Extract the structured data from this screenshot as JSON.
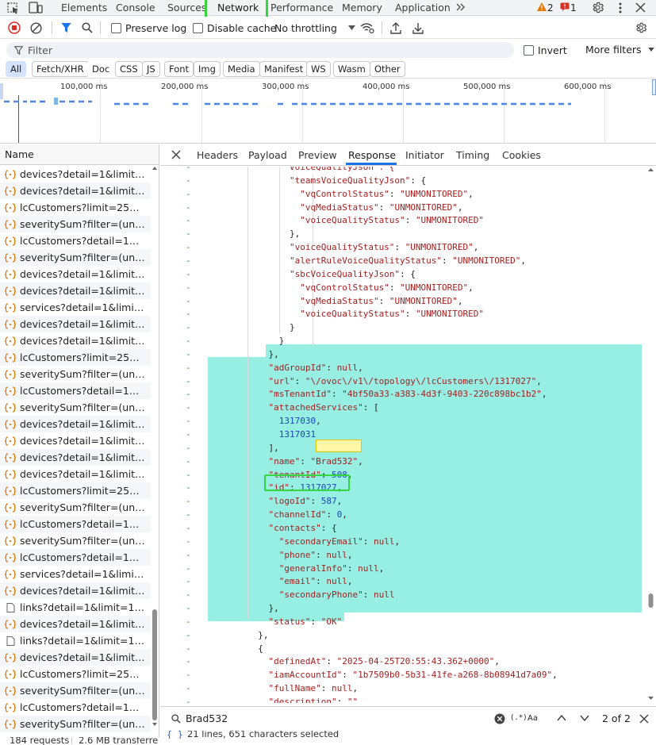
{
  "tabs": [
    "Elements",
    "Console",
    "Sources",
    "Network",
    "Performance",
    "Memory",
    "Application"
  ],
  "active_tab": "Network",
  "badges": {
    "warnings": "2",
    "errors": "1"
  },
  "toolbar": {
    "preserve_log": "Preserve log",
    "disable_cache": "Disable cache",
    "throttling": "No throttling"
  },
  "filter": {
    "placeholder": "Filter",
    "invert": "Invert",
    "more_filters": "More filters"
  },
  "type_filters": [
    "All",
    "Fetch/XHR",
    "Doc",
    "CSS",
    "JS",
    "Font",
    "Img",
    "Media",
    "Manifest",
    "WS",
    "Wasm",
    "Other"
  ],
  "timeline_ticks": [
    "100,000 ms",
    "200,000 ms",
    "300,000 ms",
    "400,000 ms",
    "500,000 ms",
    "600,000 ms"
  ],
  "list_header": "Name",
  "requests": [
    "devices?detail=1&limit=100...",
    "devices?detail=1&limit=100...",
    "lcCustomers?limit=25&pag...",
    "severitySum?filter=(unitTyp...",
    "lcCustomers?detail=1&filter...",
    "severitySum?filter=(unitTyp...",
    "devices?detail=1&limit=100...",
    "devices?detail=1&limit=100...",
    "services?detail=1&limit=10...",
    "devices?detail=1&limit=100...",
    "devices?detail=1&limit=100...",
    "lcCustomers?limit=25&pag...",
    "severitySum?filter=(unitTyp...",
    "lcCustomers?detail=1&filter...",
    "severitySum?filter=(unitTyp...",
    "devices?detail=1&limit=100...",
    "devices?detail=1&limit=100...",
    "devices?detail=1&limit=100...",
    "devices?detail=1&limit=100...",
    "lcCustomers?limit=25&pag...",
    "severitySum?filter=(unitTyp...",
    "lcCustomers?detail=1&filter...",
    "severitySum?filter=(unitTyp...",
    "lcCustomers?detail=1&limit...",
    "services?detail=1&limit=10...",
    "devices?detail=1&limit=100...",
    "links?detail=1&limit=10000...",
    "devices?detail=1&limit=100...",
    "links?detail=1&limit=10000...",
    "devices?detail=1&limit=100...",
    "lcCustomers?limit=25&pag...",
    "severitySum?filter=(unitTyp...",
    "lcCustomers?detail=1&filter...",
    "severitySum?filter=(unitTyp..."
  ],
  "detail_tabs": [
    "Headers",
    "Payload",
    "Preview",
    "Response",
    "Initiator",
    "Timing",
    "Cookies"
  ],
  "active_detail_tab": "Response",
  "response_lines": [
    [
      {
        "t": "        voiceQualityJson\": {",
        "c": "k"
      }
    ],
    [
      {
        "t": "        \"teamsVoiceQualityJson\"",
        "c": "k"
      },
      {
        "t": ": {",
        "c": "p"
      }
    ],
    [
      {
        "t": "          \"vqControlStatus\"",
        "c": "k"
      },
      {
        "t": ": ",
        "c": "p"
      },
      {
        "t": "\"UNMONITORED\"",
        "c": "s"
      },
      {
        "t": ",",
        "c": "p"
      }
    ],
    [
      {
        "t": "          \"vqMediaStatus\"",
        "c": "k"
      },
      {
        "t": ": ",
        "c": "p"
      },
      {
        "t": "\"UNMONITORED\"",
        "c": "s"
      },
      {
        "t": ",",
        "c": "p"
      }
    ],
    [
      {
        "t": "          \"voiceQualityStatus\"",
        "c": "k"
      },
      {
        "t": ": ",
        "c": "p"
      },
      {
        "t": "\"UNMONITORED\"",
        "c": "s"
      }
    ],
    [
      {
        "t": "        },",
        "c": "p"
      }
    ],
    [
      {
        "t": "        \"voiceQualityStatus\"",
        "c": "k"
      },
      {
        "t": ": ",
        "c": "p"
      },
      {
        "t": "\"UNMONITORED\"",
        "c": "s"
      },
      {
        "t": ",",
        "c": "p"
      }
    ],
    [
      {
        "t": "        \"alertRuleVoiceQualityStatus\"",
        "c": "k"
      },
      {
        "t": ": ",
        "c": "p"
      },
      {
        "t": "\"UNMONITORED\"",
        "c": "s"
      },
      {
        "t": ",",
        "c": "p"
      }
    ],
    [
      {
        "t": "        \"sbcVoiceQualityJson\"",
        "c": "k"
      },
      {
        "t": ": {",
        "c": "p"
      }
    ],
    [
      {
        "t": "          \"vqControlStatus\"",
        "c": "k"
      },
      {
        "t": ": ",
        "c": "p"
      },
      {
        "t": "\"UNMONITORED\"",
        "c": "s"
      },
      {
        "t": ",",
        "c": "p"
      }
    ],
    [
      {
        "t": "          \"vqMediaStatus\"",
        "c": "k"
      },
      {
        "t": ": ",
        "c": "p"
      },
      {
        "t": "\"UNMONITORED\"",
        "c": "s"
      },
      {
        "t": ",",
        "c": "p"
      }
    ],
    [
      {
        "t": "          \"voiceQualityStatus\"",
        "c": "k"
      },
      {
        "t": ": ",
        "c": "p"
      },
      {
        "t": "\"UNMONITORED\"",
        "c": "s"
      }
    ],
    [
      {
        "t": "        }",
        "c": "p"
      }
    ],
    [
      {
        "t": "      }",
        "c": "p"
      }
    ],
    [
      {
        "t": "    },",
        "c": "p"
      }
    ],
    [
      {
        "t": "    \"adGroupId\"",
        "c": "k"
      },
      {
        "t": ": ",
        "c": "p"
      },
      {
        "t": "null",
        "c": "nul"
      },
      {
        "t": ",",
        "c": "p"
      }
    ],
    [
      {
        "t": "    \"url\"",
        "c": "k"
      },
      {
        "t": ": ",
        "c": "p"
      },
      {
        "t": "\"\\/ovoc\\/v1\\/topology\\/lcCustomers\\/1317027\"",
        "c": "s"
      },
      {
        "t": ",",
        "c": "p"
      }
    ],
    [
      {
        "t": "    \"msTenantId\"",
        "c": "k"
      },
      {
        "t": ": ",
        "c": "p"
      },
      {
        "t": "\"4bf50a33-a383-4d3f-9403-220c898bc1b2\"",
        "c": "s"
      },
      {
        "t": ",",
        "c": "p"
      }
    ],
    [
      {
        "t": "    \"attachedServices\"",
        "c": "k"
      },
      {
        "t": ": [",
        "c": "p"
      }
    ],
    [
      {
        "t": "      1317030",
        "c": "n"
      },
      {
        "t": ",",
        "c": "p"
      }
    ],
    [
      {
        "t": "      1317031",
        "c": "n"
      }
    ],
    [
      {
        "t": "    ],",
        "c": "p"
      }
    ],
    [
      {
        "t": "    \"name\"",
        "c": "k"
      },
      {
        "t": ": ",
        "c": "p"
      },
      {
        "t": "\"Brad532\"",
        "c": "s"
      },
      {
        "t": ",",
        "c": "p"
      }
    ],
    [
      {
        "t": "    \"tenantId\"",
        "c": "k"
      },
      {
        "t": ": ",
        "c": "p"
      },
      {
        "t": "508",
        "c": "n"
      },
      {
        "t": ",",
        "c": "p"
      }
    ],
    [
      {
        "t": "    \"id\"",
        "c": "k"
      },
      {
        "t": ": ",
        "c": "p"
      },
      {
        "t": "1317027",
        "c": "n"
      },
      {
        "t": ",",
        "c": "p"
      }
    ],
    [
      {
        "t": "    \"logoId\"",
        "c": "k"
      },
      {
        "t": ": ",
        "c": "p"
      },
      {
        "t": "587",
        "c": "n"
      },
      {
        "t": ",",
        "c": "p"
      }
    ],
    [
      {
        "t": "    \"channelId\"",
        "c": "k"
      },
      {
        "t": ": ",
        "c": "p"
      },
      {
        "t": "0",
        "c": "n"
      },
      {
        "t": ",",
        "c": "p"
      }
    ],
    [
      {
        "t": "    \"contacts\"",
        "c": "k"
      },
      {
        "t": ": {",
        "c": "p"
      }
    ],
    [
      {
        "t": "      \"secondaryEmail\"",
        "c": "k"
      },
      {
        "t": ": ",
        "c": "p"
      },
      {
        "t": "null",
        "c": "nul"
      },
      {
        "t": ",",
        "c": "p"
      }
    ],
    [
      {
        "t": "      \"phone\"",
        "c": "k"
      },
      {
        "t": ": ",
        "c": "p"
      },
      {
        "t": "null",
        "c": "nul"
      },
      {
        "t": ",",
        "c": "p"
      }
    ],
    [
      {
        "t": "      \"generalInfo\"",
        "c": "k"
      },
      {
        "t": ": ",
        "c": "p"
      },
      {
        "t": "null",
        "c": "nul"
      },
      {
        "t": ",",
        "c": "p"
      }
    ],
    [
      {
        "t": "      \"email\"",
        "c": "k"
      },
      {
        "t": ": ",
        "c": "p"
      },
      {
        "t": "null",
        "c": "nul"
      },
      {
        "t": ",",
        "c": "p"
      }
    ],
    [
      {
        "t": "      \"secondaryPhone\"",
        "c": "k"
      },
      {
        "t": ": ",
        "c": "p"
      },
      {
        "t": "null",
        "c": "nul"
      }
    ],
    [
      {
        "t": "    },",
        "c": "p"
      }
    ],
    [
      {
        "t": "    \"status\"",
        "c": "k"
      },
      {
        "t": ": ",
        "c": "p"
      },
      {
        "t": "\"OK\"",
        "c": "s"
      }
    ],
    [
      {
        "t": "  },",
        "c": "p"
      }
    ],
    [
      {
        "t": "  {",
        "c": "p"
      }
    ],
    [
      {
        "t": "    \"definedAt\"",
        "c": "k"
      },
      {
        "t": ": ",
        "c": "p"
      },
      {
        "t": "\"2025-04-25T20:55:43.362+0000\"",
        "c": "s"
      },
      {
        "t": ",",
        "c": "p"
      }
    ],
    [
      {
        "t": "    \"iamAccountId\"",
        "c": "k"
      },
      {
        "t": ": ",
        "c": "p"
      },
      {
        "t": "\"1b7509b0-5b31-41fe-a268-8b08941d7a09\"",
        "c": "s"
      },
      {
        "t": ",",
        "c": "p"
      }
    ],
    [
      {
        "t": "    \"fullName\"",
        "c": "k"
      },
      {
        "t": ": ",
        "c": "p"
      },
      {
        "t": "null",
        "c": "nul"
      },
      {
        "t": ",",
        "c": "p"
      }
    ],
    [
      {
        "t": "    \"description\"",
        "c": "k"
      },
      {
        "t": ": ",
        "c": "p"
      },
      {
        "t": "\"\"",
        "c": "s"
      },
      {
        "t": ",",
        "c": "p"
      }
    ]
  ],
  "search": {
    "query": "Brad532",
    "case_label": "Aa",
    "regex_label": "(.*)",
    "match_count": "2 of 2"
  },
  "status": {
    "requests": "184 requests",
    "transferred": "2.6 MB transferred",
    "selection": "21 lines, 651 characters selected"
  }
}
